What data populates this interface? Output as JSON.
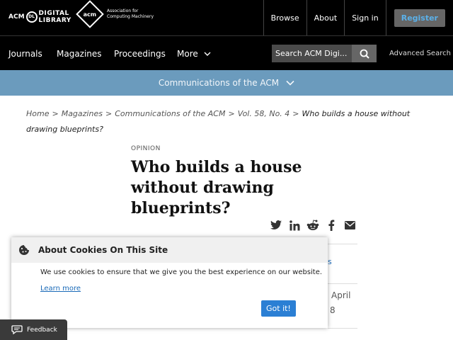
{
  "header": {
    "dl_logo_prefix": "ACM",
    "dl_logo_line1": "DIGITAL",
    "dl_logo_line2": "LIBRARY",
    "acm_logo_mark": "acm",
    "acm_logo_line1": "Association for",
    "acm_logo_line2": "Computing Machinery",
    "nav": {
      "browse": "Browse",
      "about": "About",
      "sign_in": "Sign in",
      "register": "Register"
    }
  },
  "mainnav": {
    "journals": "Journals",
    "magazines": "Magazines",
    "proceedings": "Proceedings",
    "more": "More",
    "search_placeholder": "Search ACM Digi...",
    "advanced_search": "Advanced Search"
  },
  "publication_bar": {
    "label": "Communications of the ACM"
  },
  "breadcrumbs": {
    "home": "Home",
    "magazines": "Magazines",
    "cacm": "Communications of the ACM",
    "volume": "Vol. 58, No. 4",
    "current": "Who builds a house without drawing blueprints?"
  },
  "article": {
    "section": "OPINION",
    "title": "Who builds a house without drawing blueprints?",
    "date_fragment": "April",
    "number_fragment": "8"
  },
  "cookie": {
    "title": "About Cookies On This Site",
    "body": "We use cookies to ensure that we give you the best experience on our website.",
    "learn_more": "Learn more",
    "accept": "Got it!"
  },
  "feedback": {
    "label": "Feedback"
  },
  "colors": {
    "header_bg": "#000000",
    "publication_bar_bg": "#6b9bbd",
    "register_text": "#5bb0e8",
    "accept_button": "#2b7fd4"
  }
}
